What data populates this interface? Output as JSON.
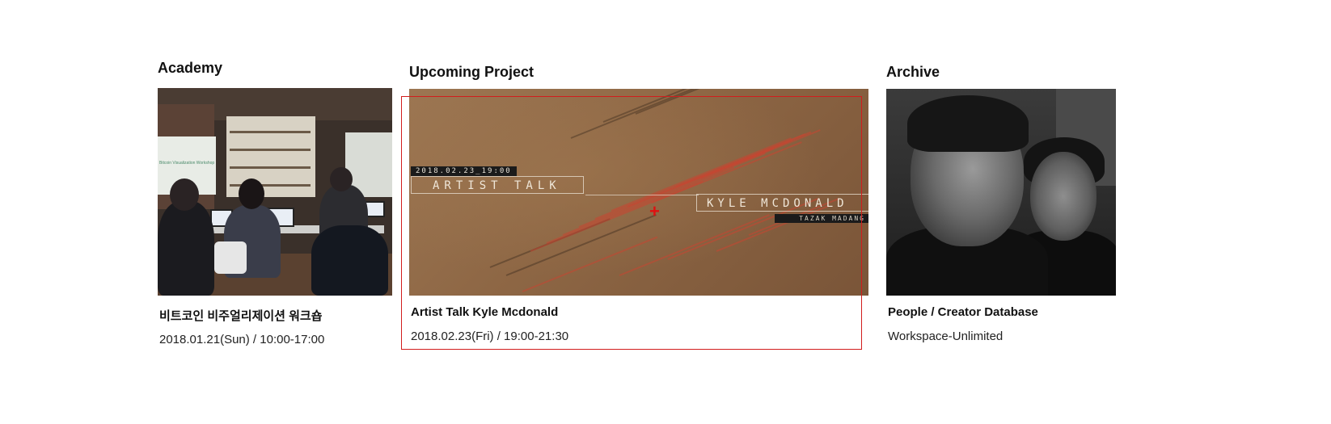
{
  "academy": {
    "heading": "Academy",
    "title": "비트코인 비주얼리제이션 워크숍",
    "meta": "2018.01.21(Sun) / 10:00-17:00",
    "screen_text": "Bitcoin Visualization Workshop"
  },
  "upcoming": {
    "heading": "Upcoming Project",
    "title": "Artist Talk Kyle Mcdonald",
    "meta": "2018.02.23(Fri) / 19:00-21:30",
    "image": {
      "date_tag": "2018.02.23_19:00",
      "artist_label": "ARTIST TALK",
      "name_label": "KYLE MCDONALD",
      "venue_label": "TAZAK MADANG"
    }
  },
  "archive": {
    "heading": "Archive",
    "title": "People / Creator Database",
    "meta": "Workspace-Unlimited"
  },
  "colors": {
    "highlight": "#d21d1d",
    "cursor": "#e01010"
  }
}
